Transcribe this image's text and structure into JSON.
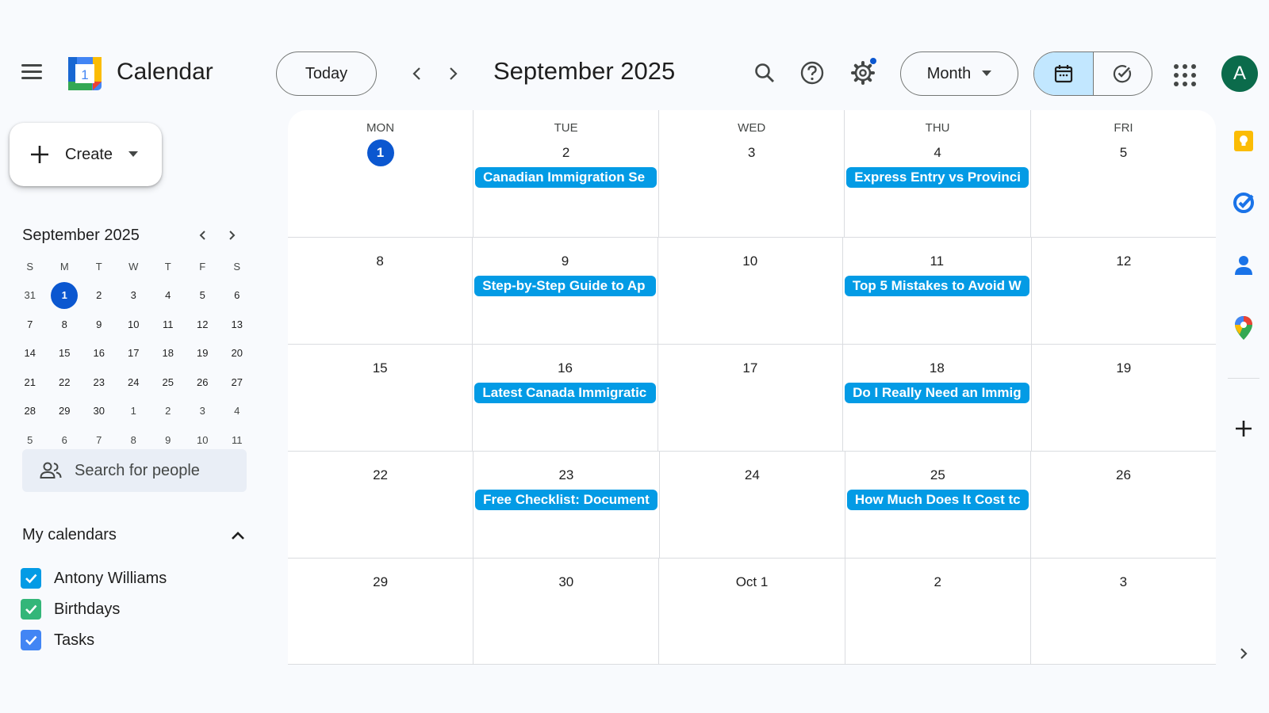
{
  "header": {
    "app_title": "Calendar",
    "logo_number": "1",
    "today_label": "Today",
    "period_title": "September 2025",
    "view_label": "Month",
    "avatar_initial": "A"
  },
  "sidebar": {
    "create_label": "Create",
    "mini_calendar": {
      "title": "September 2025",
      "days_of_week": [
        "S",
        "M",
        "T",
        "W",
        "T",
        "F",
        "S"
      ],
      "weeks": [
        [
          "31",
          "1",
          "2",
          "3",
          "4",
          "5",
          "6"
        ],
        [
          "7",
          "8",
          "9",
          "10",
          "11",
          "12",
          "13"
        ],
        [
          "14",
          "15",
          "16",
          "17",
          "18",
          "19",
          "20"
        ],
        [
          "21",
          "22",
          "23",
          "24",
          "25",
          "26",
          "27"
        ],
        [
          "28",
          "29",
          "30",
          "1",
          "2",
          "3",
          "4"
        ],
        [
          "5",
          "6",
          "7",
          "8",
          "9",
          "10",
          "11"
        ]
      ]
    },
    "search_people_placeholder": "Search for people",
    "my_calendars_title": "My calendars",
    "calendars": [
      {
        "label": "Antony Williams",
        "color": "#039be5"
      },
      {
        "label": "Birthdays",
        "color": "#33b679"
      },
      {
        "label": "Tasks",
        "color": "#4285f4"
      }
    ]
  },
  "month_view": {
    "days_of_week": [
      "MON",
      "TUE",
      "WED",
      "THU",
      "FRI"
    ],
    "weeks": [
      [
        {
          "date": "1",
          "today": true,
          "events": []
        },
        {
          "date": "2",
          "events": [
            "Canadian Immigration Se"
          ]
        },
        {
          "date": "3",
          "events": []
        },
        {
          "date": "4",
          "events": [
            "Express Entry vs Provinci"
          ]
        },
        {
          "date": "5",
          "events": []
        }
      ],
      [
        {
          "date": "8",
          "events": []
        },
        {
          "date": "9",
          "events": [
            "Step-by-Step Guide to Ap"
          ]
        },
        {
          "date": "10",
          "events": []
        },
        {
          "date": "11",
          "events": [
            "Top 5 Mistakes to Avoid W"
          ]
        },
        {
          "date": "12",
          "events": []
        }
      ],
      [
        {
          "date": "15",
          "events": []
        },
        {
          "date": "16",
          "events": [
            "Latest Canada Immigratic"
          ]
        },
        {
          "date": "17",
          "events": []
        },
        {
          "date": "18",
          "events": [
            "Do I Really Need an Immig"
          ]
        },
        {
          "date": "19",
          "events": []
        }
      ],
      [
        {
          "date": "22",
          "events": []
        },
        {
          "date": "23",
          "events": [
            "Free Checklist: Document"
          ]
        },
        {
          "date": "24",
          "events": []
        },
        {
          "date": "25",
          "events": [
            "How Much Does It Cost tc"
          ]
        },
        {
          "date": "26",
          "events": []
        }
      ],
      [
        {
          "date": "29",
          "events": []
        },
        {
          "date": "30",
          "events": []
        },
        {
          "date": "Oct 1",
          "events": []
        },
        {
          "date": "2",
          "events": []
        },
        {
          "date": "3",
          "events": []
        }
      ]
    ],
    "event_color": "#039be5"
  },
  "colors": {
    "accent": "#0b57d0",
    "selected_toggle": "#c2e7ff",
    "avatar_bg": "#0b6b4b"
  }
}
